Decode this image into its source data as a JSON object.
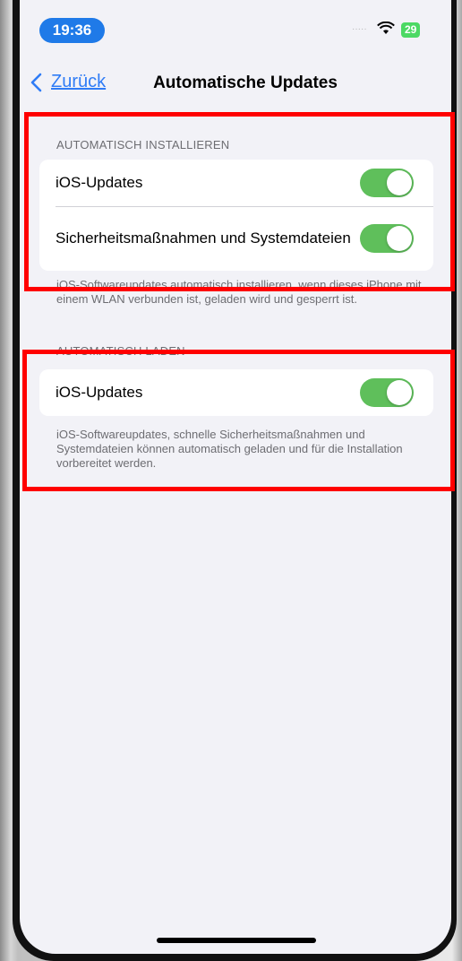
{
  "status_bar": {
    "time": "19:36",
    "signal": "·····",
    "battery": "29"
  },
  "nav": {
    "back_label": "Zurück",
    "title": "Automatische Updates"
  },
  "sections": [
    {
      "header": "AUTOMATISCH INSTALLIEREN",
      "rows": [
        {
          "label": "iOS-Updates",
          "toggle_on": true
        },
        {
          "label": "Sicherheitsmaßnahmen und Systemdateien",
          "toggle_on": true
        }
      ],
      "footer": "iOS-Softwareupdates automatisch installieren, wenn dieses iPhone mit einem WLAN verbunden ist, geladen wird und gesperrt ist."
    },
    {
      "header": "AUTOMATISCH LADEN",
      "rows": [
        {
          "label": "iOS-Updates",
          "toggle_on": true
        }
      ],
      "footer": "iOS-Softwareupdates, schnelle Sicherheitsmaßnahmen und Systemdateien können automatisch geladen und für die Installation vorbereitet werden."
    }
  ],
  "colors": {
    "accent": "#2f7cf6",
    "toggle_on": "#5fbf5b",
    "highlight": "#ff0000",
    "background": "#f2f2f7"
  }
}
